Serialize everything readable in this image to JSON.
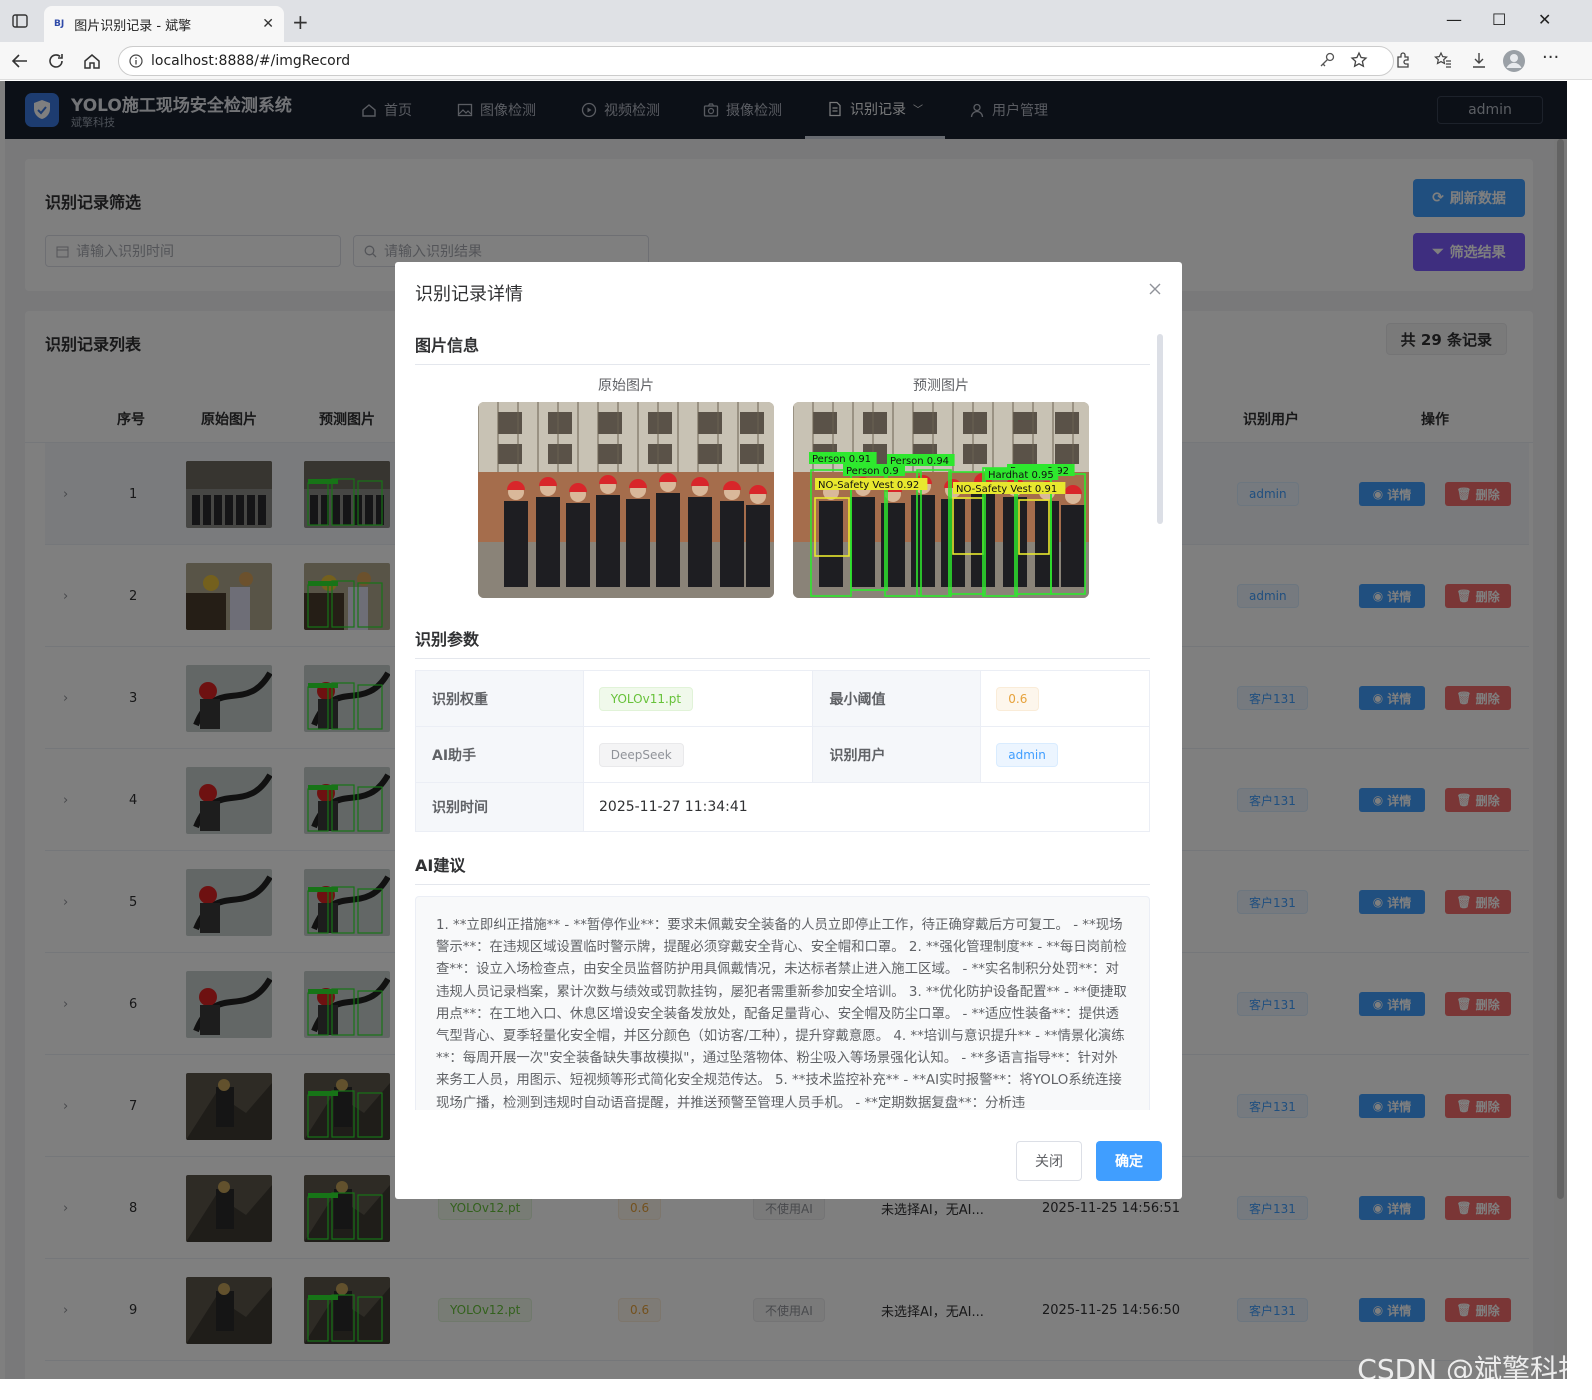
{
  "browser": {
    "tab_favicon": "BJ",
    "tab_title": "图片识别记录 - 斌擎",
    "url": "localhost:8888/#/imgRecord"
  },
  "app": {
    "title": "YOLO施工现场安全检测系统",
    "subtitle": "斌擎科技",
    "nav": [
      {
        "label": "首页",
        "icon": "home-icon"
      },
      {
        "label": "图像检测",
        "icon": "image-icon"
      },
      {
        "label": "视频检测",
        "icon": "video-icon"
      },
      {
        "label": "摄像检测",
        "icon": "camera-icon"
      },
      {
        "label": "识别记录",
        "icon": "document-icon"
      },
      {
        "label": "用户管理",
        "icon": "user-icon"
      }
    ],
    "user": "admin"
  },
  "filter": {
    "title": "识别记录筛选",
    "time_placeholder": "请输入识别时间",
    "result_placeholder": "请输入识别结果",
    "refresh_label": "刷新数据",
    "filter_label": "筛选结果"
  },
  "list": {
    "title": "识别记录列表",
    "count_label": "共 29 条记录",
    "columns": {
      "index": "序号",
      "orig": "原始图片",
      "pred": "预测图片",
      "user": "识别用户",
      "ops": "操作"
    },
    "detail_label": "详情",
    "delete_label": "删除",
    "rows": [
      {
        "index": "1",
        "user": "admin",
        "scene": "crowd"
      },
      {
        "index": "2",
        "user": "admin",
        "scene": "workers"
      },
      {
        "index": "3",
        "user": "客户131",
        "scene": "cable"
      },
      {
        "index": "4",
        "user": "客户131",
        "scene": "cable"
      },
      {
        "index": "5",
        "user": "客户131",
        "scene": "cable"
      },
      {
        "index": "6",
        "user": "客户131",
        "scene": "cable"
      },
      {
        "index": "7",
        "user": "客户131",
        "scene": "rock"
      },
      {
        "index": "8",
        "user": "客户131",
        "scene": "rock",
        "weight": "YOLOv12.pt",
        "thresh": "0.6",
        "ai": "不使用AI",
        "advice": "未选择AI，无AI...",
        "time": "2025-11-25 14:56:51"
      },
      {
        "index": "9",
        "user": "客户131",
        "scene": "rock",
        "weight": "YOLOv12.pt",
        "thresh": "0.6",
        "ai": "不使用AI",
        "advice": "未选择AI，无AI...",
        "time": "2025-11-25 14:56:50"
      }
    ]
  },
  "dialog": {
    "title": "识别记录详情",
    "section_images": "图片信息",
    "orig_caption": "原始图片",
    "pred_caption": "预测图片",
    "detections": [
      "Person 0.91",
      "Person 0.94",
      "Person 0.92",
      "Person 0.9",
      "Hardhat 0.95",
      "NO-Safety Vest 0.92",
      "NO-Safety Vest 0.91"
    ],
    "section_params": "识别参数",
    "params": {
      "weight_label": "识别权重",
      "weight": "YOLOv11.pt",
      "thresh_label": "最小阈值",
      "thresh": "0.6",
      "ai_label": "AI助手",
      "ai": "DeepSeek",
      "user_label": "识别用户",
      "user": "admin",
      "time_label": "识别时间",
      "time": "2025-11-27 11:34:41"
    },
    "section_advice": "AI建议",
    "advice": "1. **立即纠正措施** - **暂停作业**：要求未佩戴安全装备的人员立即停止工作，待正确穿戴后方可复工。 - **现场警示**：在违规区域设置临时警示牌，提醒必须穿戴安全背心、安全帽和口罩。 2. **强化管理制度** - **每日岗前检查**：设立入场检查点，由安全员监督防护用具佩戴情况，未达标者禁止进入施工区域。 - **实名制积分处罚**：对违规人员记录档案，累计次数与绩效或罚款挂钩，屡犯者需重新参加安全培训。 3. **优化防护设备配置** - **便捷取用点**：在工地入口、休息区增设安全装备发放处，配备足量背心、安全帽及防尘口罩。 - **适应性装备**：提供透气型背心、夏季轻量化安全帽，并区分颜色（如访客/工种），提升穿戴意愿。 4. **培训与意识提升** - **情景化演练**：每周开展一次\"安全装备缺失事故模拟\"，通过坠落物体、粉尘吸入等场景强化认知。 - **多语言指导**：针对外来务工人员，用图示、短视频等形式简化安全规范传达。 5. **技术监控补充** - **AI实时报警**：将YOLO系统连接现场广播，检测到违规时自动语音提醒，并推送预警至管理人员手机。 - **定期数据复盘**：分析违",
    "close_label": "关闭",
    "confirm_label": "确定"
  },
  "watermark": "CSDN @斌擎科技",
  "colors": {
    "primary": "#409eff",
    "danger": "#f56c6c",
    "header": "#19212f",
    "refresh": "#409eff",
    "filter": "#7c5cff"
  }
}
